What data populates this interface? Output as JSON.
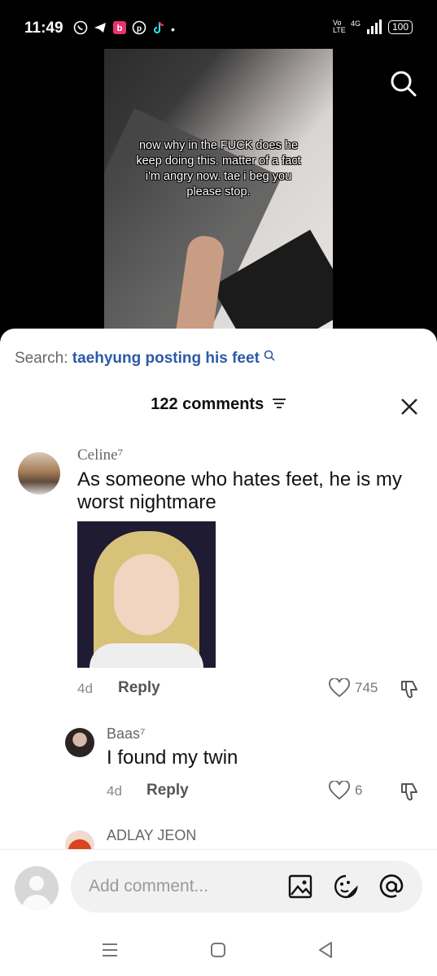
{
  "status_bar": {
    "time": "11:49",
    "notification_icons": [
      "whatsapp-icon",
      "telegram-icon",
      "bereal-icon",
      "pinterest-icon",
      "tiktok-icon"
    ],
    "dot": "•",
    "network": "4G",
    "volte": "Vo LTE",
    "battery": "100"
  },
  "video": {
    "caption": "now why in the FUCK does he keep doing this. matter of a fact i'm angry now. tae i beg you please stop."
  },
  "sheet": {
    "search_label": "Search:",
    "search_term": "taehyung posting his feet",
    "comments_count": "122 comments"
  },
  "comments": [
    {
      "user": "Celine⁷",
      "text": "As someone who hates feet, he is my worst nightmare",
      "age": "4d",
      "reply_label": "Reply",
      "likes": "745"
    },
    {
      "user": "Baas⁷",
      "text": "I found my twin",
      "age": "4d",
      "reply_label": "Reply",
      "likes": "6"
    },
    {
      "user": "ADLAY JEON"
    }
  ],
  "composer": {
    "placeholder": "Add comment..."
  },
  "colors": {
    "accent_link": "#2b5aa8",
    "sheet_bg": "#ffffff",
    "input_bg": "#f1f1f2"
  }
}
